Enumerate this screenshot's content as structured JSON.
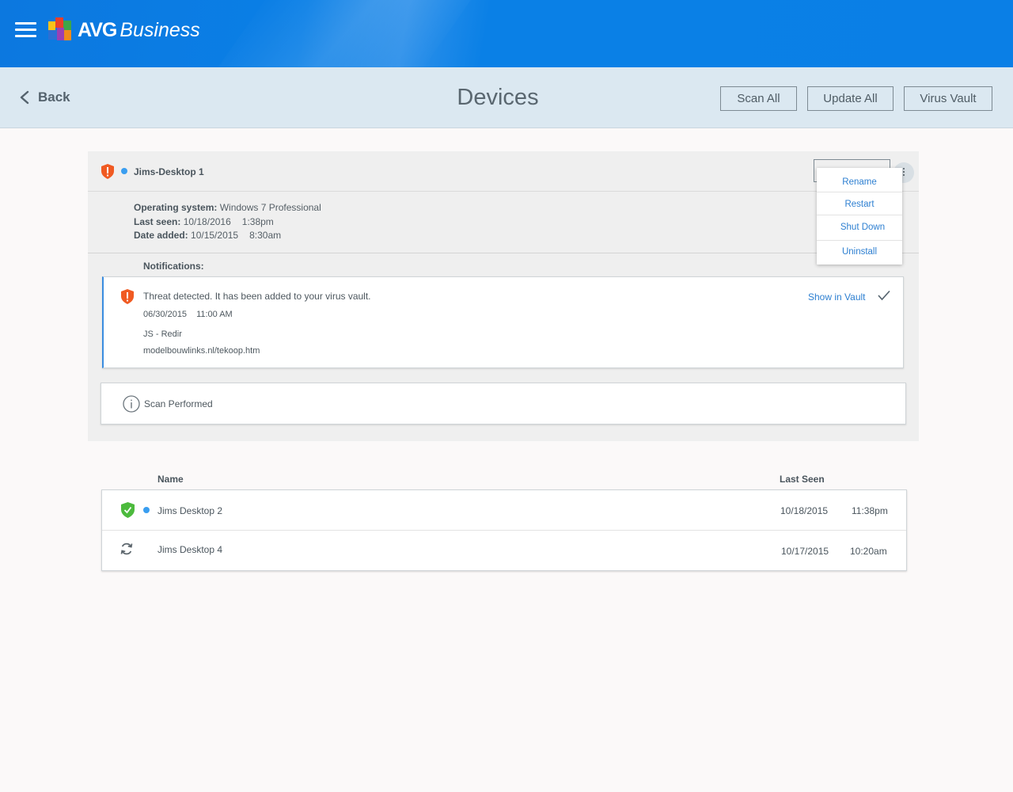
{
  "header": {
    "brand_name": "AVG",
    "brand_suffix": "Business"
  },
  "subheader": {
    "back_label": "Back",
    "title": "Devices",
    "buttons": {
      "scan_all": "Scan All",
      "update_all": "Update All",
      "virus_vault": "Virus Vault"
    }
  },
  "device": {
    "name": "Jims-Desktop 1",
    "os_label": "Operating system:",
    "os_value": "Windows 7 Professional",
    "last_seen_label": "Last seen:",
    "last_seen_date": "10/18/2016",
    "last_seen_time": "1:38pm",
    "date_added_label": "Date added:",
    "date_added_date": "10/15/2015",
    "date_added_time": "8:30am",
    "notifications_label": "Notifications:",
    "notification": {
      "message": "Threat detected. It has been added to your virus vault.",
      "date": "06/30/2015",
      "time": "11:00 AM",
      "threat_name": "JS - Redir",
      "threat_path": "modelbouwlinks.nl/tekoop.htm",
      "action": "Show in Vault"
    },
    "scan_event": "Scan Performed"
  },
  "menu": {
    "items": [
      "Rename",
      "Restart",
      "Shut Down",
      "Uninstall"
    ]
  },
  "device_list": {
    "columns": {
      "name": "Name",
      "last_seen": "Last Seen"
    },
    "rows": [
      {
        "status": "protected",
        "name": "Jims Desktop 2",
        "date": "10/18/2015",
        "time": "11:38pm"
      },
      {
        "status": "syncing",
        "name": "Jims Desktop 4",
        "date": "10/17/2015",
        "time": "10:20am"
      }
    ]
  },
  "colors": {
    "topbar": "#0a7fe6",
    "subheader": "#dbe8f1",
    "link": "#2d7fd1",
    "threat": "#f05a22",
    "safe": "#4cba3d",
    "online_dot": "#3a9ef0"
  },
  "icons": {
    "menu": "hamburger-icon",
    "back": "chevron-left-icon",
    "threat": "shield-alert-icon",
    "safe": "shield-check-icon",
    "sync": "sync-icon",
    "info": "info-icon",
    "more": "more-vert-icon",
    "dismiss": "checkmark-icon"
  }
}
